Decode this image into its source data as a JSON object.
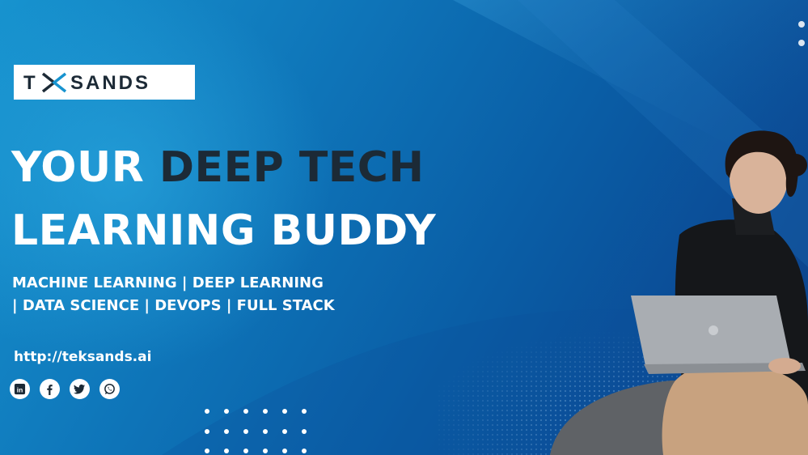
{
  "brand": {
    "logo_text": "TEKSANDS",
    "colors": {
      "navy": "#1c2a36",
      "accent_blue": "#1793cf",
      "white": "#ffffff"
    }
  },
  "headline": {
    "line1_white": "YOUR",
    "line1_dark": "DEEP TECH",
    "line2": "LEARNING BUDDY"
  },
  "topics": {
    "line1": "MACHINE LEARNING | DEEP LEARNING",
    "line2": "| DATA SCIENCE | DEVOPS | FULL STACK"
  },
  "website": "http://teksands.ai",
  "social_icons": [
    "linkedin-icon",
    "facebook-icon",
    "twitter-icon",
    "whatsapp-icon"
  ],
  "social_labels": {
    "linkedin": "in"
  }
}
